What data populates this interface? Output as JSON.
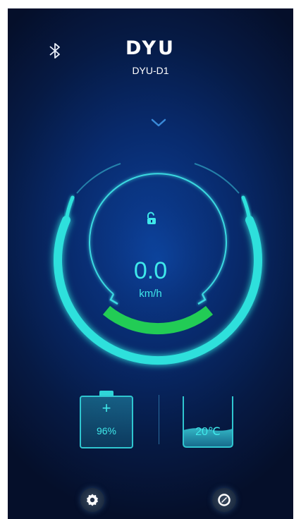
{
  "header": {
    "bluetooth_icon": "bluetooth-icon",
    "brand": "DYU",
    "device_name": "DYU-D1",
    "expand_icon": "chevron-down-icon"
  },
  "speedometer": {
    "lock_icon": "unlock-icon",
    "speed": "0.0",
    "unit": "km/h"
  },
  "battery": {
    "plus": "+",
    "percent": "96%",
    "level": 0.96
  },
  "temperature": {
    "label": "20℃"
  },
  "bottom_nav": {
    "settings_icon": "settings-icon",
    "navigation_icon": "compass-icon"
  },
  "colors": {
    "accent": "#3fe8ea",
    "gauge_ring": "#2fe0dc",
    "speed_bar": "#22cc55",
    "background": "#061a44"
  }
}
